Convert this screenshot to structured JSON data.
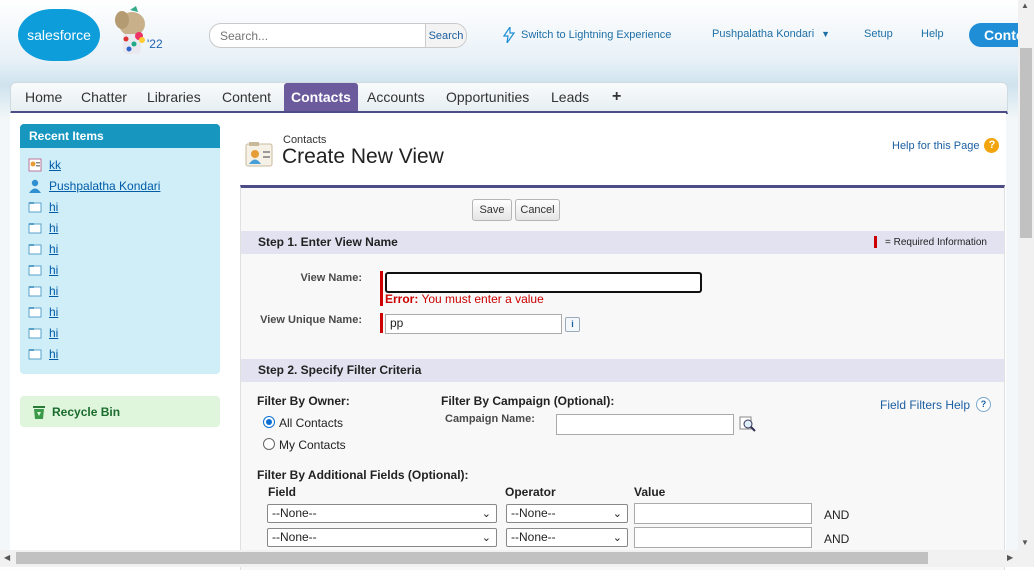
{
  "header": {
    "logo_text": "salesforce",
    "mascot_badge": "'22",
    "search_placeholder": "Search...",
    "search_button": "Search",
    "lightning_link": "Switch to Lightning Experience",
    "user_menu": "Pushpalatha Kondari",
    "setup": "Setup",
    "help": "Help",
    "contest_button": "Conte"
  },
  "tabs": [
    {
      "label": "Home",
      "active": false
    },
    {
      "label": "Chatter",
      "active": false
    },
    {
      "label": "Libraries",
      "active": false
    },
    {
      "label": "Content",
      "active": false
    },
    {
      "label": "Contacts",
      "active": true
    },
    {
      "label": "Accounts",
      "active": false
    },
    {
      "label": "Opportunities",
      "active": false
    },
    {
      "label": "Leads",
      "active": false
    },
    {
      "label": "+",
      "active": false
    }
  ],
  "sidebar": {
    "recent_title": "Recent Items",
    "items": [
      {
        "label": "kk",
        "icon": "contact-card-icon"
      },
      {
        "label": "Pushpalatha Kondari",
        "icon": "user-icon"
      },
      {
        "label": "hi",
        "icon": "folder-icon"
      },
      {
        "label": "hi",
        "icon": "folder-icon"
      },
      {
        "label": "hi",
        "icon": "folder-icon"
      },
      {
        "label": "hi",
        "icon": "folder-icon"
      },
      {
        "label": "hi",
        "icon": "folder-icon"
      },
      {
        "label": "hi",
        "icon": "folder-icon"
      },
      {
        "label": "hi",
        "icon": "folder-icon"
      },
      {
        "label": "hi",
        "icon": "folder-icon"
      }
    ],
    "recycle_bin": "Recycle Bin"
  },
  "page": {
    "object": "Contacts",
    "title": "Create New View",
    "help_link": "Help for this Page"
  },
  "form": {
    "save": "Save",
    "cancel": "Cancel",
    "step1_title": "Step 1. Enter View Name",
    "required_info": "= Required Information",
    "view_name_label": "View Name:",
    "view_name_value": "",
    "error_prefix": "Error:",
    "error_text": " You must enter a value",
    "unique_name_label": "View Unique Name:",
    "unique_name_value": "pp",
    "step2_title": "Step 2. Specify Filter Criteria",
    "filter_owner_label": "Filter By Owner:",
    "owner_options": [
      "All Contacts",
      "My Contacts"
    ],
    "owner_selected": "All Contacts",
    "filter_campaign_label": "Filter By Campaign (Optional):",
    "campaign_name_label": "Campaign Name:",
    "campaign_name_value": "",
    "field_filters_help": "Field Filters Help",
    "additional_fields_label": "Filter By Additional Fields (Optional):",
    "columns": [
      "Field",
      "Operator",
      "Value"
    ],
    "rows": [
      {
        "field": "--None--",
        "operator": "--None--",
        "value": "",
        "conjunction": "AND"
      },
      {
        "field": "--None--",
        "operator": "--None--",
        "value": "",
        "conjunction": "AND"
      }
    ]
  }
}
